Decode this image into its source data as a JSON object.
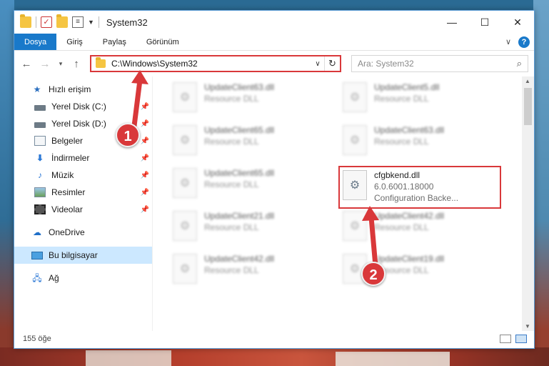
{
  "window": {
    "title": "System32",
    "controls": {
      "minimize": "—",
      "maximize": "☐",
      "close": "✕"
    }
  },
  "ribbon": {
    "tabs": [
      "Dosya",
      "Giriş",
      "Paylaş",
      "Görünüm"
    ],
    "help": "?"
  },
  "address": {
    "path": "C:\\Windows\\System32",
    "search_placeholder": "Ara: System32"
  },
  "nav": {
    "items": [
      {
        "label": "Hızlı erişim",
        "icon": "star-icon"
      },
      {
        "label": "Yerel Disk (C:)",
        "icon": "drive-icon",
        "pinned": true
      },
      {
        "label": "Yerel Disk (D:)",
        "icon": "drive-icon",
        "pinned": true
      },
      {
        "label": "Belgeler",
        "icon": "documents-icon",
        "pinned": true
      },
      {
        "label": "İndirmeler",
        "icon": "downloads-icon",
        "pinned": true
      },
      {
        "label": "Müzik",
        "icon": "music-icon",
        "pinned": true
      },
      {
        "label": "Resimler",
        "icon": "pictures-icon",
        "pinned": true
      },
      {
        "label": "Videolar",
        "icon": "videos-icon",
        "pinned": true
      },
      {
        "label": "OneDrive",
        "icon": "cloud-icon"
      },
      {
        "label": "Bu bilgisayar",
        "icon": "computer-icon",
        "selected": true
      },
      {
        "label": "Ağ",
        "icon": "network-icon"
      }
    ]
  },
  "files": {
    "left_column": [
      {
        "name": "UpdateClient63.dll",
        "type": "Resource DLL"
      },
      {
        "name": "UpdateClient65.dll",
        "type": "Resource DLL"
      },
      {
        "name": "UpdateClient65.dll",
        "type": "Resource DLL"
      },
      {
        "name": "UpdateClient21.dll",
        "type": "Resource DLL"
      },
      {
        "name": "UpdateClient42.dll",
        "type": "Resource DLL"
      }
    ],
    "right_column": [
      {
        "name": "UpdateClient5.dll",
        "type": "Resource DLL"
      },
      {
        "name": "UpdateClient63.dll",
        "type": "Resource DLL"
      },
      {
        "name": "cfgbkend.dll",
        "version": "6.0.6001.18000",
        "type": "Configuration Backe..."
      },
      {
        "name": "UpdateClient42.dll",
        "type": "Resource DLL"
      },
      {
        "name": "UpdateClient19.dll",
        "type": "Resource DLL"
      }
    ]
  },
  "status": {
    "count": "155 öğe"
  },
  "callouts": {
    "one": "1",
    "two": "2"
  },
  "colors": {
    "highlight": "#d9383a",
    "accent": "#1979ca",
    "selected_nav": "#cce8ff"
  }
}
